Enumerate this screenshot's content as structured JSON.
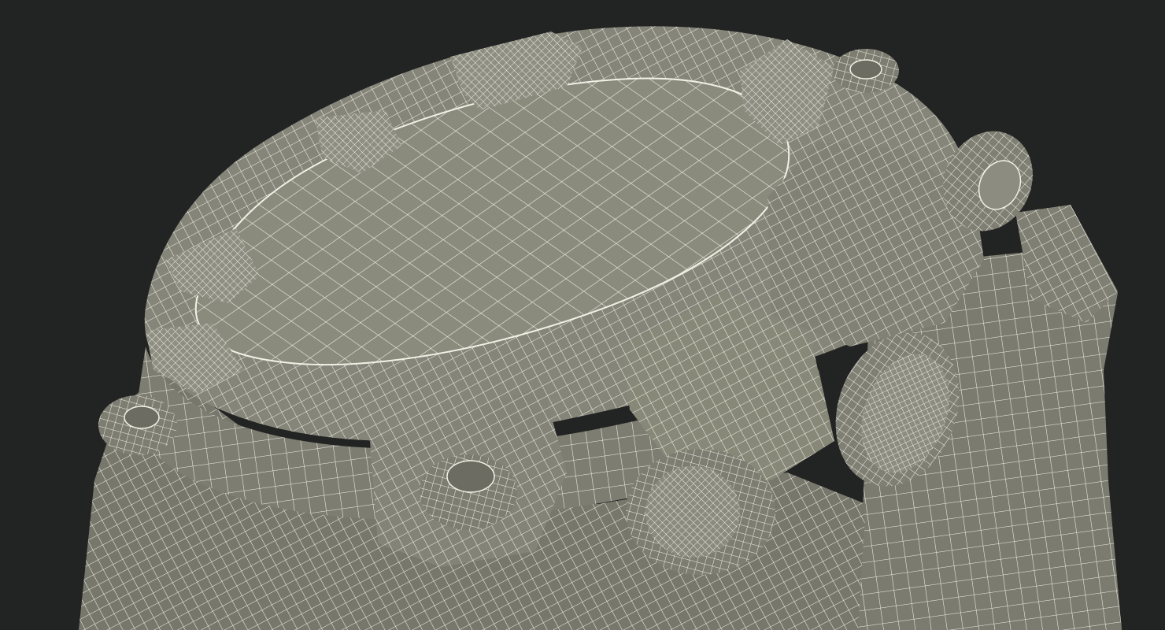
{
  "viewport": {
    "background_color": "#222323",
    "subject": "wireframe-watch-model"
  },
  "render": {
    "surface_color": "#8a8a7c",
    "surface_shadow_color": "#5f5f55",
    "surface_light_color": "#a4a496",
    "wire_color": "#f1f1e6"
  }
}
